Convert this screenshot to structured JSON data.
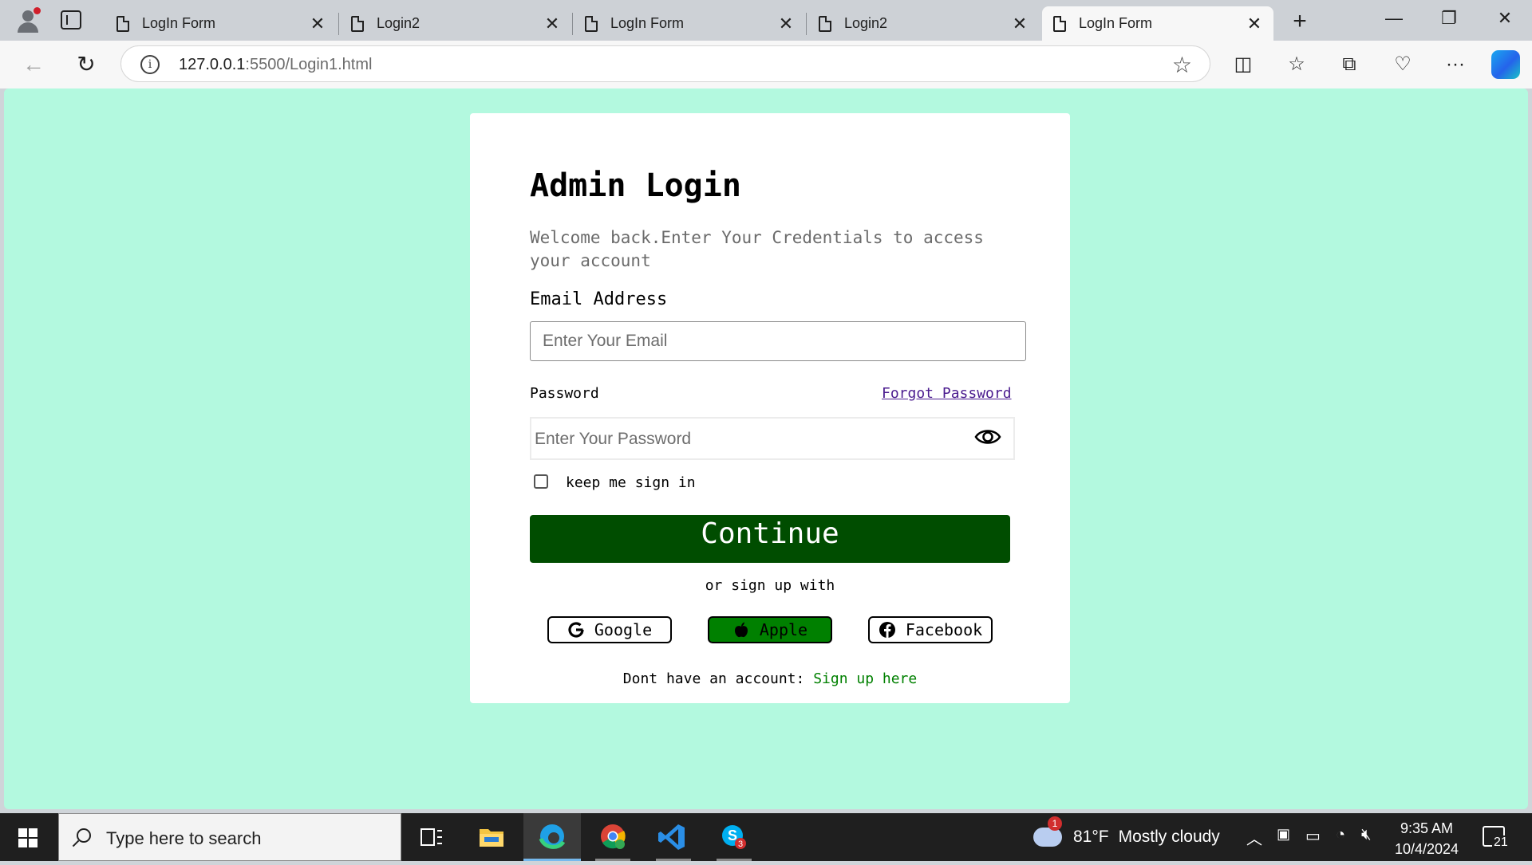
{
  "browser": {
    "tabs": [
      {
        "label": "LogIn Form",
        "active": false
      },
      {
        "label": "Login2",
        "active": false
      },
      {
        "label": "LogIn Form",
        "active": false
      },
      {
        "label": "Login2",
        "active": false
      },
      {
        "label": "LogIn Form",
        "active": true
      }
    ],
    "url_host": "127.0.0.1",
    "url_rest": ":5500/Login1.html",
    "icons": [
      "profile-icon",
      "tab-actions-icon",
      "back-icon",
      "refresh-icon",
      "info-icon",
      "favorite-star-icon",
      "split-screen-icon",
      "favorites-icon",
      "collections-icon",
      "browser-essentials-icon",
      "more-icon",
      "copilot-icon"
    ]
  },
  "page": {
    "background": "#b3f9df",
    "title": "Admin Login",
    "subtitle": "Welcome back.Enter Your Credentials to access your account",
    "email_label": "Email Address",
    "email_placeholder": "Enter Your Email",
    "password_label": "Password",
    "forgot_label": "Forgot Password",
    "password_placeholder": "Enter Your Password",
    "keep_signed_label": "keep me sign in",
    "continue_label": "Continue",
    "continue_color": "#004d00",
    "or_text": "or sign up with",
    "social": {
      "google": "Google",
      "apple": "Apple",
      "facebook": "Facebook"
    },
    "apple_color": "#008000",
    "signup_prefix": "Dont have an account: ",
    "signup_link": "Sign up here"
  },
  "taskbar": {
    "search_placeholder": "Type here to search",
    "weather_temp": "81°F",
    "weather_text": "Mostly cloudy",
    "weather_badge": "1",
    "skype_badge": "3",
    "time": "9:35 AM",
    "date": "10/4/2024",
    "notifications": "21"
  }
}
